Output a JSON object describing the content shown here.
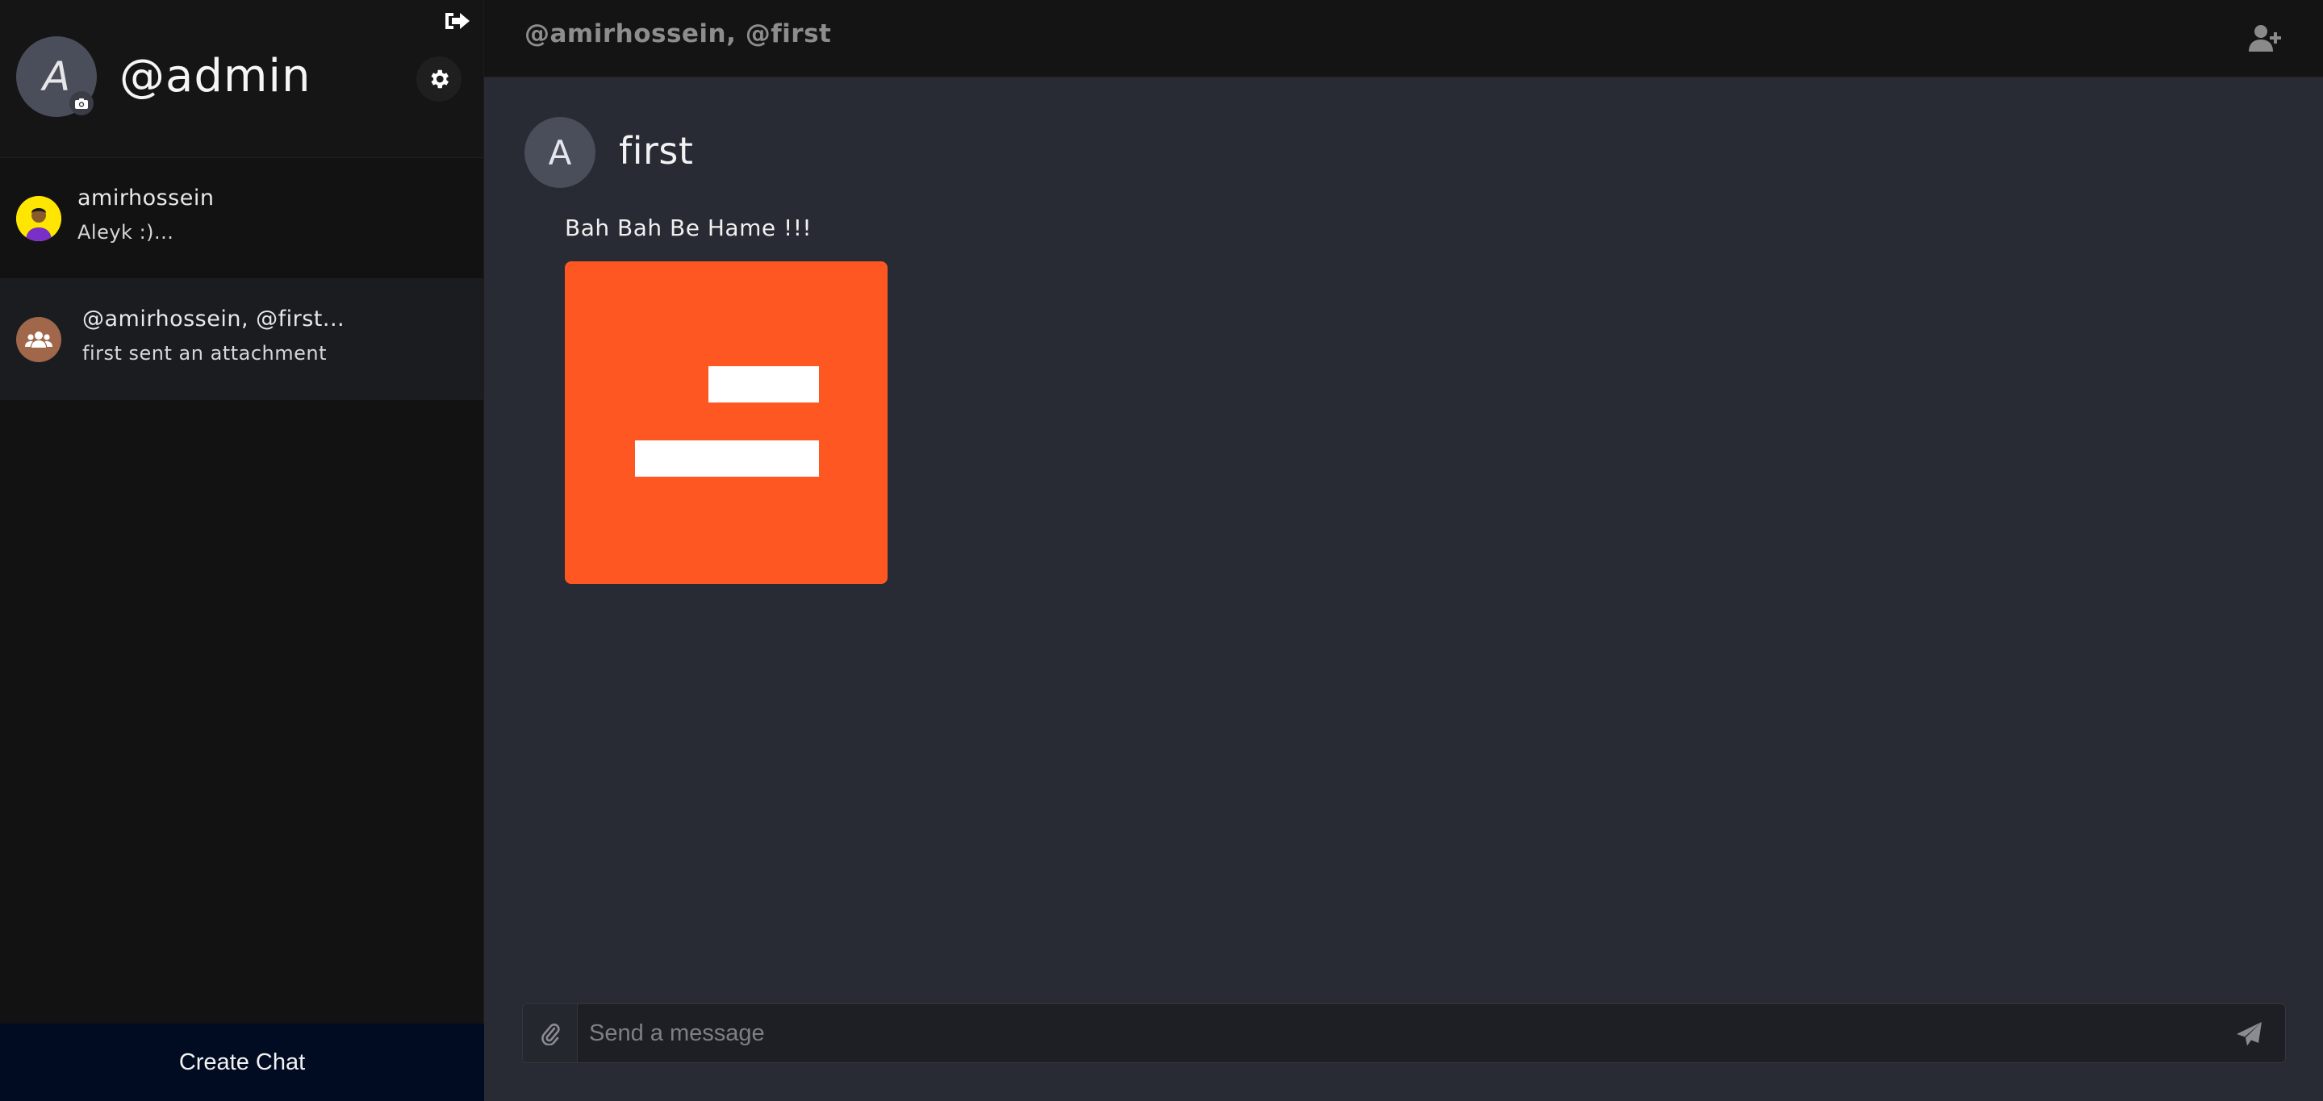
{
  "profile": {
    "initial": "A",
    "username": "@admin"
  },
  "chats": [
    {
      "title": "amirhossein",
      "preview": "Aleyk :)..."
    },
    {
      "title": "@amirhossein, @first...",
      "preview": "first sent an attachment"
    }
  ],
  "sidebar": {
    "create_chat_label": "Create Chat"
  },
  "topbar": {
    "title": "@amirhossein, @first"
  },
  "conversation": {
    "sender_initial": "A",
    "sender_name": "first",
    "message_text": "Bah Bah Be Hame !!!"
  },
  "composer": {
    "placeholder": "Send a message",
    "value": ""
  },
  "colors": {
    "attachment": "#ff5722",
    "create_chat_bg": "#010b22",
    "group_avatar": "#a0674b",
    "user_avatar": "#ffe600"
  },
  "icons": {
    "logout": "logout-icon",
    "camera": "camera-icon",
    "settings": "gear-icon",
    "add_user": "add-user-icon",
    "attach": "paperclip-icon",
    "send": "send-icon",
    "group": "group-icon"
  }
}
